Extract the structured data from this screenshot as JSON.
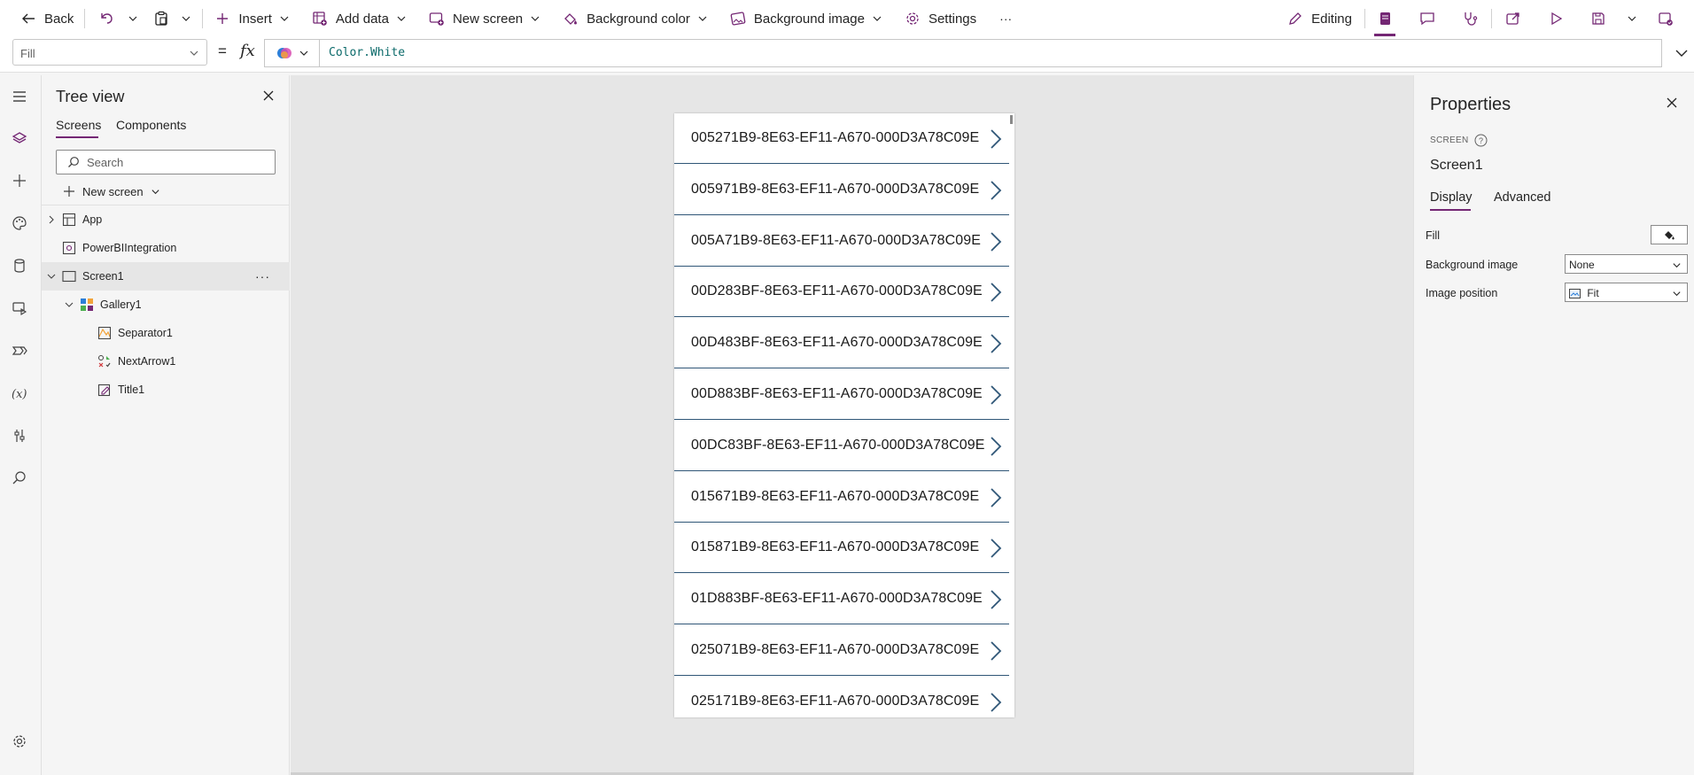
{
  "cmdbar": {
    "back": "Back",
    "insert": "Insert",
    "add_data": "Add data",
    "new_screen": "New screen",
    "background_color": "Background color",
    "background_image": "Background image",
    "settings": "Settings",
    "more": "···",
    "editing": "Editing"
  },
  "formula": {
    "property": "Fill",
    "equals": "=",
    "fx": "fx",
    "text": "Color.White"
  },
  "tree": {
    "title": "Tree view",
    "tabs": [
      "Screens",
      "Components"
    ],
    "search_placeholder": "Search",
    "new_screen": "New screen",
    "nodes": [
      "App",
      "PowerBIIntegration",
      "Screen1",
      "Gallery1",
      "Separator1",
      "NextArrow1",
      "Title1"
    ],
    "more": "···"
  },
  "gallery": {
    "items": [
      "005271B9-8E63-EF11-A670-000D3A78C09E",
      "005971B9-8E63-EF11-A670-000D3A78C09E",
      "005A71B9-8E63-EF11-A670-000D3A78C09E",
      "00D283BF-8E63-EF11-A670-000D3A78C09E",
      "00D483BF-8E63-EF11-A670-000D3A78C09E",
      "00D883BF-8E63-EF11-A670-000D3A78C09E",
      "00DC83BF-8E63-EF11-A670-000D3A78C09E",
      "015671B9-8E63-EF11-A670-000D3A78C09E",
      "015871B9-8E63-EF11-A670-000D3A78C09E",
      "01D883BF-8E63-EF11-A670-000D3A78C09E",
      "025071B9-8E63-EF11-A670-000D3A78C09E",
      "025171B9-8E63-EF11-A670-000D3A78C09E"
    ]
  },
  "properties": {
    "title": "Properties",
    "kind_label": "SCREEN",
    "screen_name": "Screen1",
    "tabs": [
      "Display",
      "Advanced"
    ],
    "fill_label": "Fill",
    "background_image_label": "Background image",
    "background_image_value": "None",
    "image_position_label": "Image position",
    "image_position_value": "Fit"
  },
  "colors": {
    "accent": "#742774",
    "separator": "#2f5677",
    "arrow": "#2f5677"
  }
}
